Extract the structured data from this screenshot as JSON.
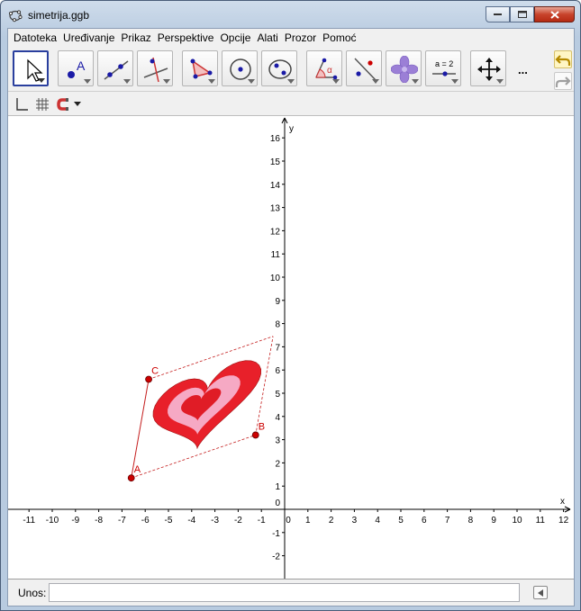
{
  "window": {
    "title": "simetrija.ggb"
  },
  "menu": [
    "Datoteka",
    "Uređivanje",
    "Prikaz",
    "Perspektive",
    "Opcije",
    "Alati",
    "Prozor",
    "Pomoć"
  ],
  "toolbar": {
    "tools": [
      {
        "name": "move-tool",
        "icon": "arrow-pointer-icon"
      },
      {
        "name": "point-tool",
        "icon": "point-icon",
        "label": "A"
      },
      {
        "name": "line-tool",
        "icon": "line-icon"
      },
      {
        "name": "perpendicular-tool",
        "icon": "perpendicular-line-icon"
      },
      {
        "name": "polygon-tool",
        "icon": "polygon-icon"
      },
      {
        "name": "circle-tool",
        "icon": "circle-center-icon"
      },
      {
        "name": "ellipse-tool",
        "icon": "ellipse-icon"
      },
      {
        "name": "angle-tool",
        "icon": "angle-icon",
        "label": "α"
      },
      {
        "name": "reflect-tool",
        "icon": "reflect-icon"
      },
      {
        "name": "image-tool",
        "icon": "flower-image-icon"
      },
      {
        "name": "slider-tool",
        "icon": "slider-icon",
        "label": "a = 2"
      },
      {
        "name": "move-view-tool",
        "icon": "move-graphics-icon"
      }
    ],
    "more": "..."
  },
  "stylebar": {
    "icons": [
      "axes-icon",
      "grid-icon",
      "point-capture-icon"
    ]
  },
  "graphics": {
    "x_label": "x",
    "y_label": "y",
    "x_ticks": [
      "-11",
      "-10",
      "-9",
      "-8",
      "-7",
      "-6",
      "-5",
      "-4",
      "-3",
      "-2",
      "-1",
      "0",
      "1",
      "2",
      "3",
      "4",
      "5",
      "6",
      "7",
      "8",
      "9",
      "10",
      "11",
      "12"
    ],
    "y_ticks": [
      "16",
      "15",
      "14",
      "13",
      "12",
      "11",
      "10",
      "9",
      "8",
      "7",
      "6",
      "5",
      "4",
      "3",
      "2",
      "1",
      "0",
      "-1",
      "-2"
    ],
    "points": [
      {
        "label": "A",
        "x": -6.6,
        "y": 1.35
      },
      {
        "label": "B",
        "x": -1.25,
        "y": 3.2
      },
      {
        "label": "C",
        "x": -5.85,
        "y": 5.6
      }
    ],
    "colors": {
      "point": "#cc0000",
      "heart_outer": "#e8202a",
      "heart_mid": "#f6a9c4",
      "heart_inner": "#e01c26",
      "frame": "#c41e1e"
    }
  },
  "inputbar": {
    "label": "Unos:",
    "value": ""
  }
}
